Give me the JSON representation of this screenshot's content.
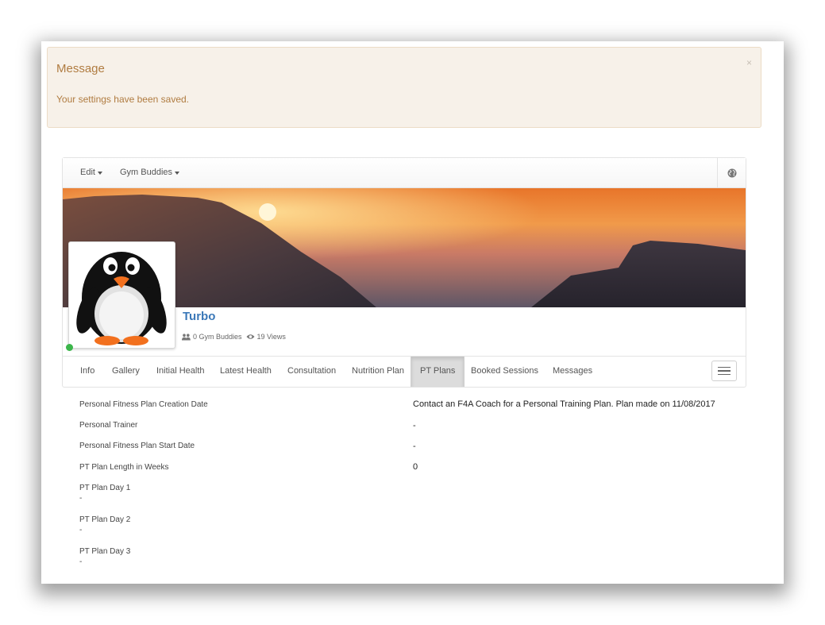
{
  "alert": {
    "title": "Message",
    "text": "Your settings have been saved.",
    "close": "×"
  },
  "topnav": {
    "items": [
      {
        "label": "Edit"
      },
      {
        "label": "Gym Buddies"
      }
    ],
    "globe_icon": "globe-icon"
  },
  "profile": {
    "name": "Turbo",
    "buddies": "0 Gym Buddies",
    "views": "19 Views",
    "online_color": "#3bb54a"
  },
  "tabs": [
    {
      "label": "Info"
    },
    {
      "label": "Gallery"
    },
    {
      "label": "Initial Health"
    },
    {
      "label": "Latest Health"
    },
    {
      "label": "Consultation"
    },
    {
      "label": "Nutrition Plan"
    },
    {
      "label": "PT Plans",
      "active": true
    },
    {
      "label": "Booked Sessions"
    },
    {
      "label": "Messages"
    }
  ],
  "details": {
    "creation_date_label": "Personal Fitness Plan Creation Date",
    "creation_date_value": "Contact an F4A Coach for a Personal Training Plan. Plan made on 11/08/2017",
    "trainer_label": "Personal Trainer",
    "trainer_value": "-",
    "start_date_label": "Personal Fitness Plan Start Date",
    "start_date_value": "-",
    "length_label": "PT Plan Length in Weeks",
    "length_value": "0",
    "days": [
      {
        "label": "PT Plan Day 1",
        "value": "-"
      },
      {
        "label": "PT Plan Day 2",
        "value": "-"
      },
      {
        "label": "PT Plan Day 3",
        "value": "-"
      }
    ]
  },
  "colors": {
    "alert_bg": "#f7f1e9",
    "alert_text": "#b07c41",
    "name_link": "#3b78b8",
    "active_tab_bg": "#dcdcdc"
  }
}
